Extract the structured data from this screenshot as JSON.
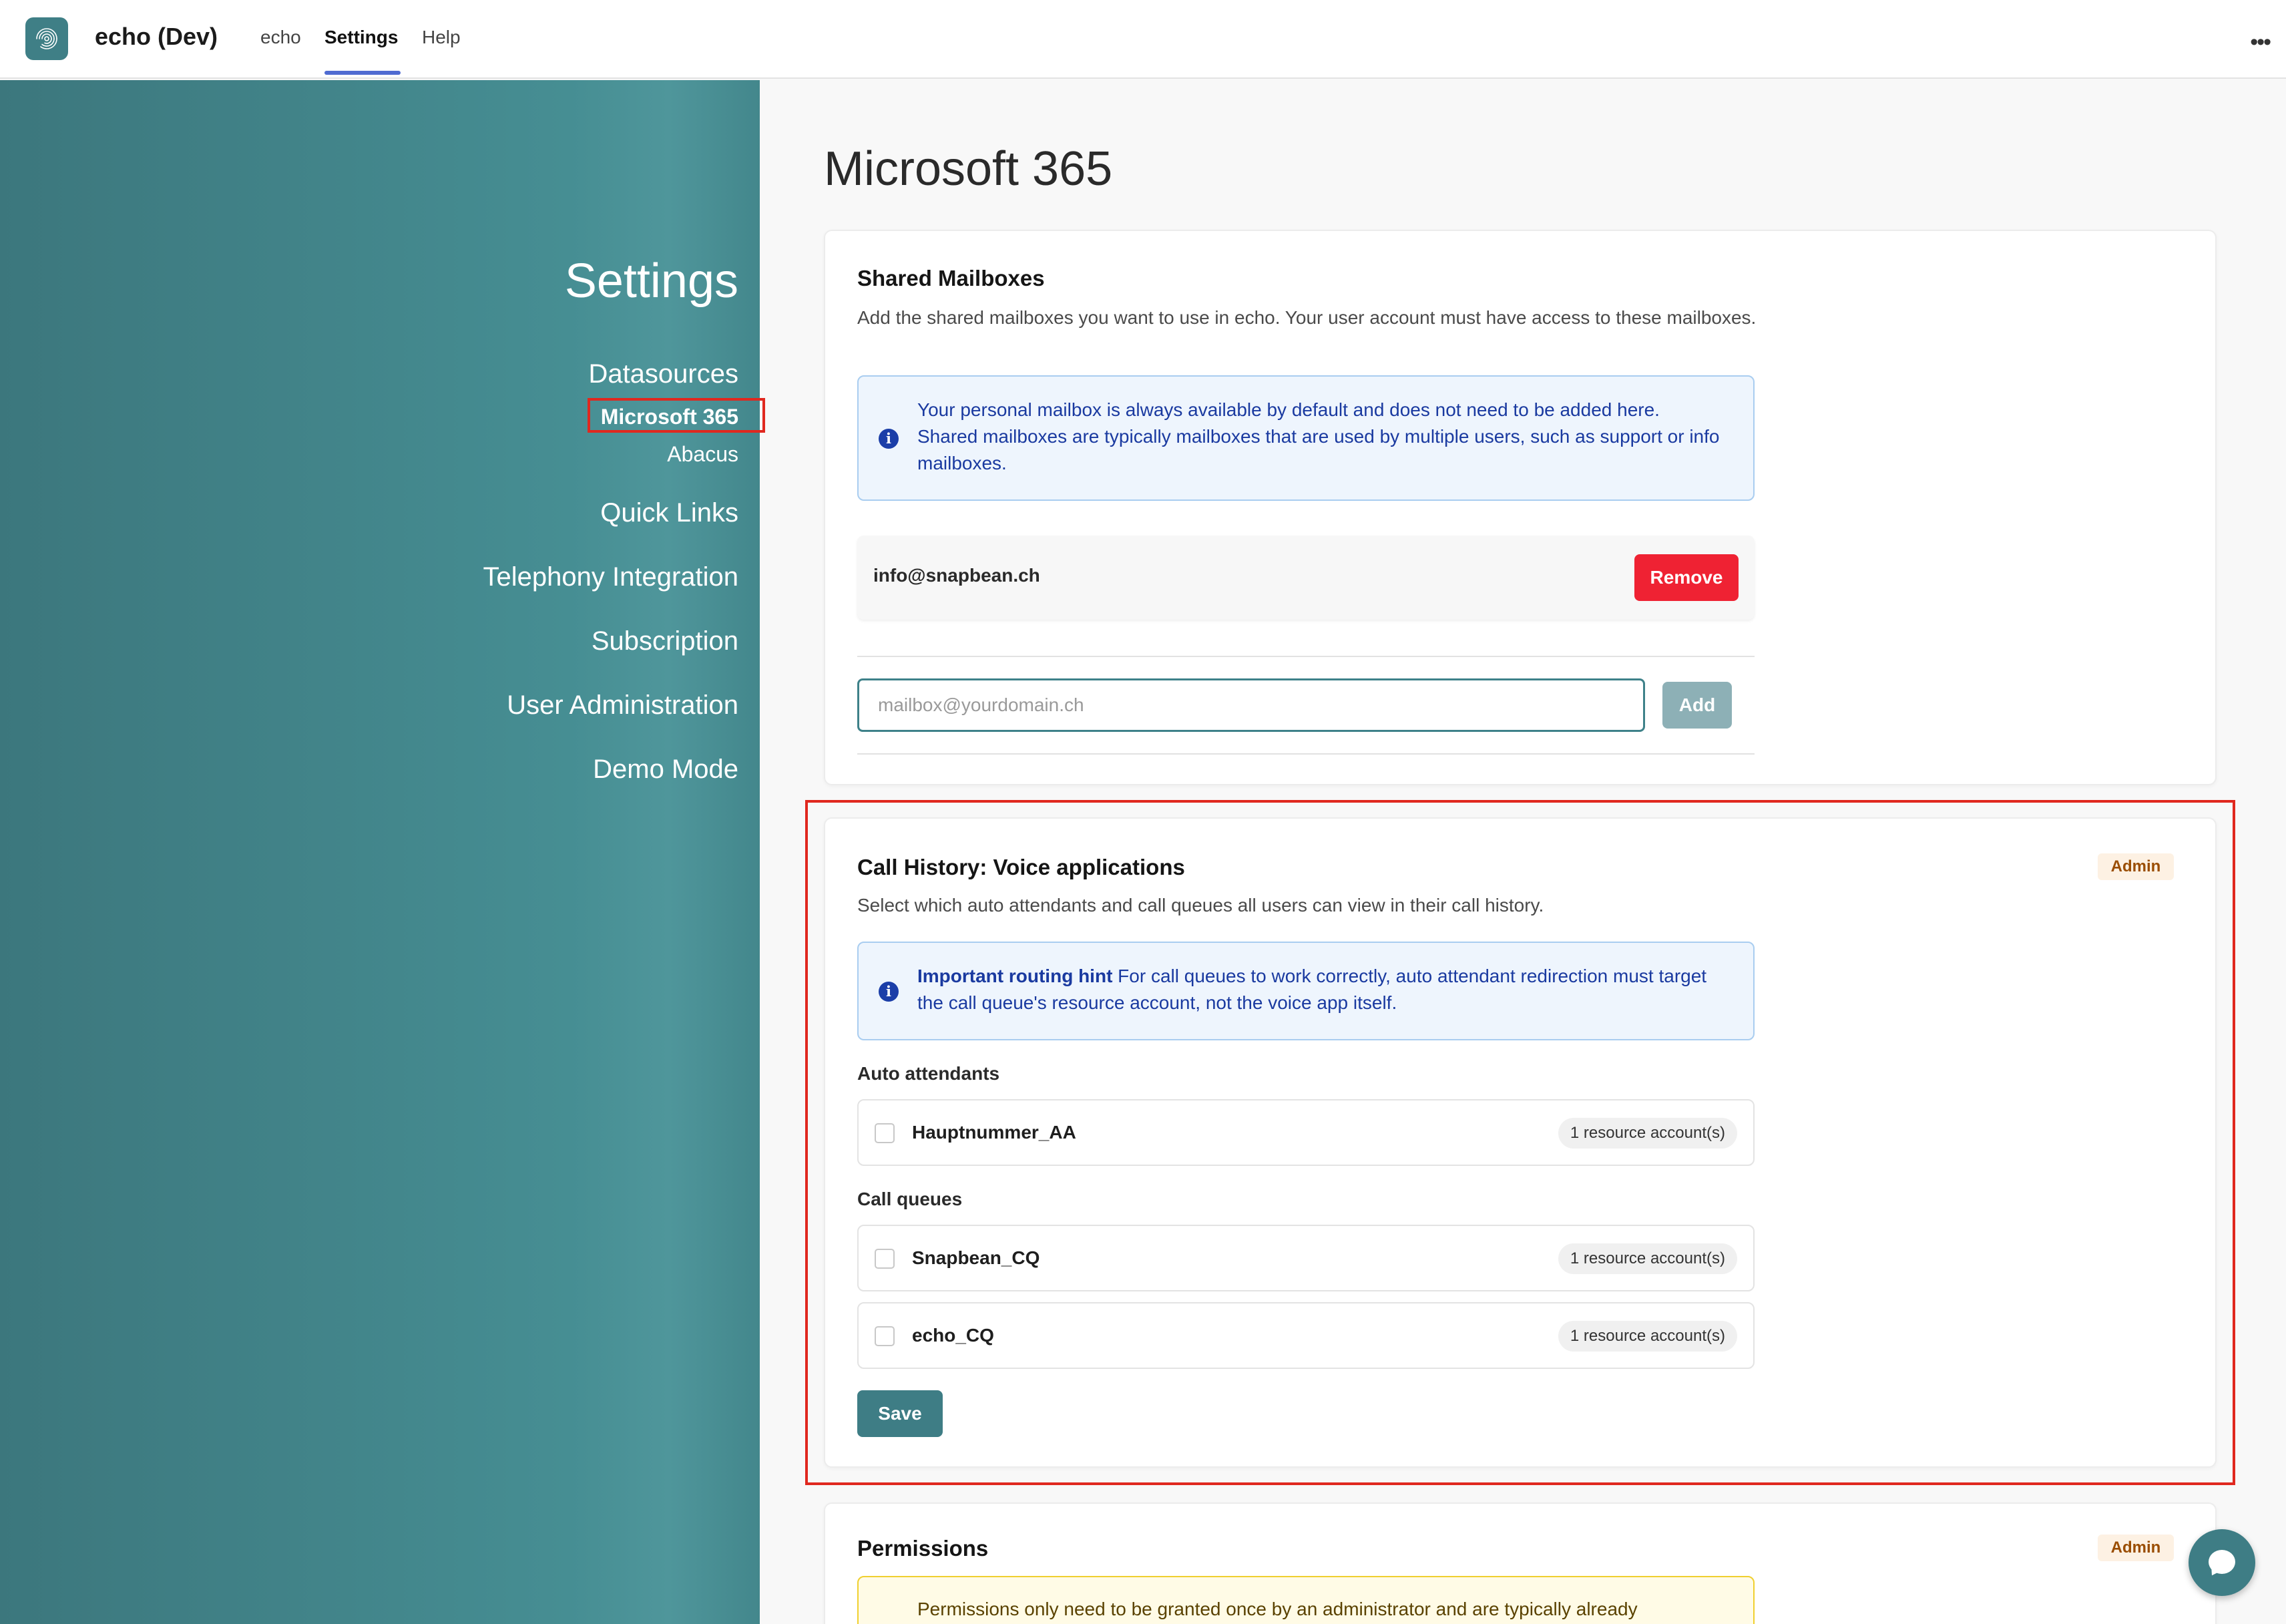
{
  "app": {
    "title": "echo (Dev)",
    "nav": [
      "echo",
      "Settings",
      "Help"
    ],
    "active_nav": "Settings",
    "more_icon": "more-horizontal-icon",
    "logo_icon": "fingerprint-logo-icon"
  },
  "sidebar": {
    "heading": "Settings",
    "items": [
      {
        "label": "Datasources"
      },
      {
        "label": "Microsoft 365"
      },
      {
        "label": "Abacus"
      },
      {
        "label": "Quick Links"
      },
      {
        "label": "Telephony Integration"
      },
      {
        "label": "Subscription"
      },
      {
        "label": "User Administration"
      },
      {
        "label": "Demo Mode"
      }
    ],
    "selected": "Microsoft 365"
  },
  "page": {
    "title": "Microsoft 365"
  },
  "shared_mailboxes": {
    "title": "Shared Mailboxes",
    "description": "Add the shared mailboxes you want to use in echo. Your user account must have access to these mailboxes.",
    "info_line1": "Your personal mailbox is always available by default and does not need to be added here.",
    "info_line2": "Shared mailboxes are typically mailboxes that are used by multiple users, such as support or info mailboxes.",
    "mailboxes": [
      {
        "address": "info@snapbean.ch"
      }
    ],
    "remove_label": "Remove",
    "input_placeholder": "mailbox@yourdomain.ch",
    "add_label": "Add"
  },
  "call_history": {
    "title": "Call History: Voice applications",
    "badge": "Admin",
    "description": "Select which auto attendants and call queues all users can view in their call history.",
    "hint_title": "Important routing hint",
    "hint_text": "For call queues to work correctly, auto attendant redirection must target the call queue's resource account, not the voice app itself.",
    "auto_attendants_label": "Auto attendants",
    "auto_attendants": [
      {
        "name": "Hauptnummer_AA",
        "resources": "1 resource account(s)",
        "checked": false
      }
    ],
    "call_queues_label": "Call queues",
    "call_queues": [
      {
        "name": "Snapbean_CQ",
        "resources": "1 resource account(s)",
        "checked": false
      },
      {
        "name": "echo_CQ",
        "resources": "1 resource account(s)",
        "checked": false
      }
    ],
    "save_label": "Save"
  },
  "permissions": {
    "title": "Permissions",
    "badge": "Admin",
    "warning": "Permissions only need to be granted once by an administrator and are typically already"
  },
  "chat": {
    "icon": "chat-bubble-icon"
  },
  "colors": {
    "accent": "#3e7d85",
    "danger": "#ef2233",
    "info_text": "#1a3aa0",
    "highlight": "#e0281f"
  }
}
